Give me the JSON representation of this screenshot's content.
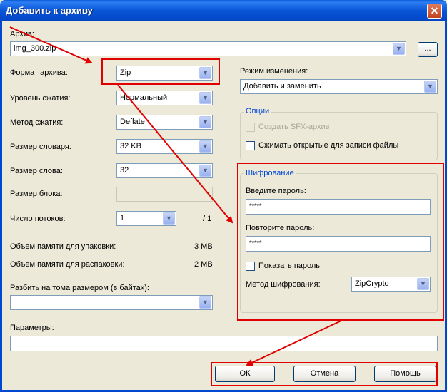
{
  "window": {
    "title": "Добавить к архиву",
    "close_glyph": "✕"
  },
  "archive": {
    "label": "Архив:",
    "value": "img_300.zip",
    "browse_label": "..."
  },
  "left": {
    "format": {
      "label": "Формат архива:",
      "value": "Zip"
    },
    "level": {
      "label": "Уровень сжатия:",
      "value": "Нормальный"
    },
    "method": {
      "label": "Метод сжатия:",
      "value": "Deflate"
    },
    "dict": {
      "label": "Размер словаря:",
      "value": "32 KB"
    },
    "word": {
      "label": "Размер слова:",
      "value": "32"
    },
    "block": {
      "label": "Размер блока:",
      "value": ""
    },
    "threads": {
      "label": "Число потоков:",
      "value": "1",
      "max": "/ 1"
    },
    "mem_pack": {
      "label": "Объем памяти для упаковки:",
      "value": "3 MB"
    },
    "mem_unpack": {
      "label": "Объем памяти для распаковки:",
      "value": "2 MB"
    },
    "split": {
      "label": "Разбить на тома размером (в байтах):",
      "value": ""
    },
    "params": {
      "label": "Параметры:",
      "value": ""
    }
  },
  "right": {
    "update_mode": {
      "label": "Режим изменения:",
      "value": "Добавить и заменить"
    },
    "options": {
      "title": "Опции",
      "sfx_label": "Создать SFX-архив",
      "shared_label": "Сжимать открытые для записи файлы"
    },
    "encryption": {
      "title": "Шифрование",
      "password_label": "Введите пароль:",
      "password_value": "*****",
      "repeat_label": "Повторите пароль:",
      "repeat_value": "*****",
      "show_label": "Показать пароль",
      "method_label": "Метод шифрования:",
      "method_value": "ZipCrypto"
    }
  },
  "buttons": {
    "ok": "ОК",
    "cancel": "Отмена",
    "help": "Помощь"
  },
  "colors": {
    "title_bar": "#0a5ed9",
    "annotation": "#e00000",
    "group_title": "#0046d5"
  },
  "icons": {
    "dropdown": "▼"
  }
}
